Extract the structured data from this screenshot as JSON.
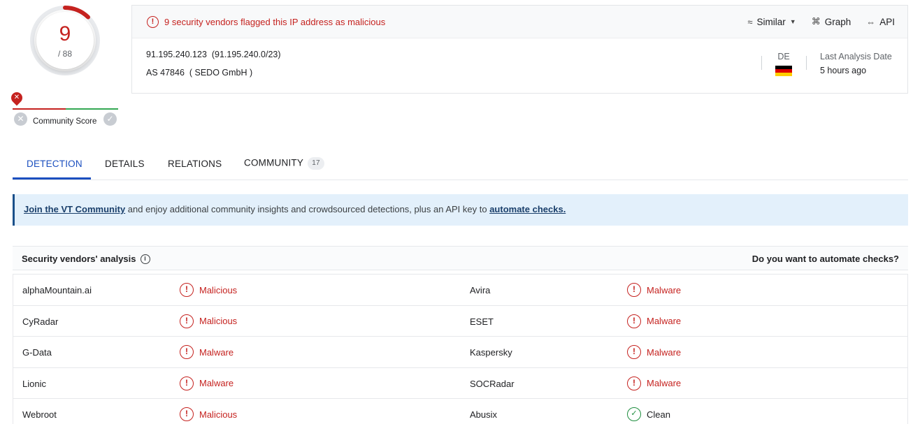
{
  "score": {
    "detections": "9",
    "total": "/ 88",
    "accent": "#c5221f"
  },
  "community_score": {
    "label": "Community Score",
    "marker_icon": "x-icon",
    "negative_icon": "x-icon",
    "positive_icon": "check-icon"
  },
  "header": {
    "alert_text": "9 security vendors flagged this IP address as malicious",
    "alert_icon": "alert-circle-icon",
    "actions": {
      "similar": "Similar",
      "graph": "Graph",
      "api": "API"
    },
    "ip": "91.195.240.123",
    "network": "(91.195.240.0/23)",
    "as_prefix": "AS 47846",
    "as_owner": "( SEDO GmbH )",
    "country_code": "DE",
    "last_analysis_label": "Last Analysis Date",
    "last_analysis_value": "5 hours ago"
  },
  "tabs": [
    {
      "label": "DETECTION",
      "active": true
    },
    {
      "label": "DETAILS"
    },
    {
      "label": "RELATIONS"
    },
    {
      "label": "COMMUNITY",
      "count": "17"
    }
  ],
  "banner": {
    "link1": "Join the VT Community",
    "text": " and enjoy additional community insights and crowdsourced detections, plus an API key to ",
    "link2": "automate checks."
  },
  "analysis": {
    "title": "Security vendors' analysis",
    "automate": "Do you want to automate checks?",
    "rows": [
      {
        "v1": "alphaMountain.ai",
        "r1": "Malicious",
        "v2": "Avira",
        "r2": "Malware"
      },
      {
        "v1": "CyRadar",
        "r1": "Malicious",
        "v2": "ESET",
        "r2": "Malware"
      },
      {
        "v1": "G-Data",
        "r1": "Malware",
        "v2": "Kaspersky",
        "r2": "Malware"
      },
      {
        "v1": "Lionic",
        "r1": "Malware",
        "v2": "SOCRadar",
        "r2": "Malware"
      },
      {
        "v1": "Webroot",
        "r1": "Malicious",
        "v2": "Abusix",
        "r2": "Clean"
      }
    ]
  },
  "colors": {
    "malicious": "#c5221f",
    "clean": "#1e8e3e",
    "active_tab": "#1b4fbf",
    "banner_bg": "#e3f0fb"
  }
}
